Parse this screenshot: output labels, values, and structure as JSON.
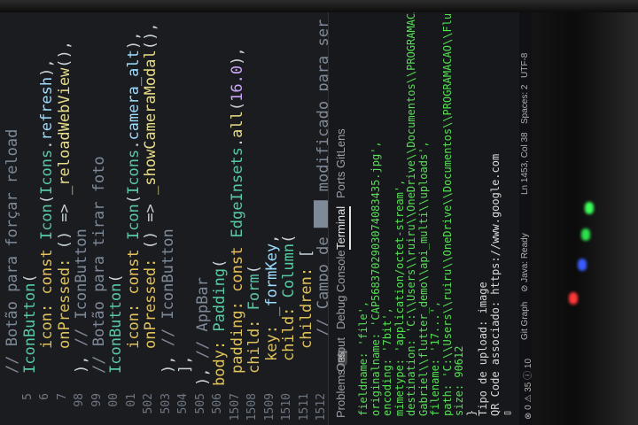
{
  "editor": {
    "line_numbers": [
      "",
      "5",
      "6",
      "7",
      "98",
      "99",
      "00",
      "01",
      "502",
      "503",
      "504",
      "505",
      "506",
      "1507",
      "1508",
      "1509",
      "1510",
      "1511",
      "1512"
    ],
    "lines": [
      {
        "parts": [
          [
            "cmt",
            "// Botão para forçar reload"
          ]
        ],
        "indent": 0
      },
      {
        "parts": [
          [
            "cls",
            "IconButton"
          ],
          [
            "pun",
            "("
          ]
        ],
        "indent": 0
      },
      {
        "parts": [
          [
            "prop",
            "icon: "
          ],
          [
            "kw",
            "const "
          ],
          [
            "cls",
            "Icon"
          ],
          [
            "pun",
            "("
          ],
          [
            "cls",
            "Icons"
          ],
          [
            "pun",
            "."
          ],
          [
            "ident",
            "refresh"
          ],
          [
            "pun",
            "),"
          ]
        ],
        "indent": 2
      },
      {
        "parts": [
          [
            "prop",
            "onPressed: "
          ],
          [
            "pun",
            "() => "
          ],
          [
            "fn",
            "_reloadWebView"
          ],
          [
            "pun",
            "(),"
          ]
        ],
        "indent": 2
      },
      {
        "parts": [
          [
            "pun",
            "), "
          ],
          [
            "cmt",
            "// IconButton"
          ]
        ],
        "indent": 0
      },
      {
        "parts": [
          [
            "cmt",
            "// Botão para tirar foto"
          ]
        ],
        "indent": 0
      },
      {
        "parts": [
          [
            "cls",
            "IconButton"
          ],
          [
            "pun",
            "("
          ]
        ],
        "indent": 0
      },
      {
        "parts": [
          [
            "prop",
            "icon: "
          ],
          [
            "kw",
            "const "
          ],
          [
            "cls",
            "Icon"
          ],
          [
            "pun",
            "("
          ],
          [
            "cls",
            "Icons"
          ],
          [
            "pun",
            "."
          ],
          [
            "ident",
            "camera_alt"
          ],
          [
            "pun",
            "),"
          ]
        ],
        "indent": 2
      },
      {
        "parts": [
          [
            "prop",
            "onPressed: "
          ],
          [
            "pun",
            "() => "
          ],
          [
            "fn",
            "_showCameraModal"
          ],
          [
            "pun",
            "(),"
          ]
        ],
        "indent": 2
      },
      {
        "parts": [
          [
            "pun",
            "), "
          ],
          [
            "cmt",
            "// IconButton"
          ]
        ],
        "indent": 0
      },
      {
        "parts": [
          [
            "pun",
            "],"
          ]
        ],
        "indent": 0
      },
      {
        "parts": [
          [
            "pun",
            "), "
          ],
          [
            "cmt",
            "// AppBar"
          ]
        ],
        "indent": -1
      },
      {
        "parts": [
          [
            "prop",
            "body: "
          ],
          [
            "cls",
            "Padding"
          ],
          [
            "pun",
            "("
          ]
        ],
        "indent": -1
      },
      {
        "parts": [
          [
            "prop",
            "padding: "
          ],
          [
            "kw",
            "const "
          ],
          [
            "cls",
            "EdgeInsets"
          ],
          [
            "pun",
            "."
          ],
          [
            "fn",
            "all"
          ],
          [
            "pun",
            "("
          ],
          [
            "num",
            "16.0"
          ],
          [
            "pun",
            "),"
          ]
        ],
        "indent": 0
      },
      {
        "parts": [
          [
            "prop",
            "child: "
          ],
          [
            "cls",
            "Form"
          ],
          [
            "pun",
            "("
          ]
        ],
        "indent": 0
      },
      {
        "parts": [
          [
            "prop",
            "key: "
          ],
          [
            "ident",
            "_formKey"
          ],
          [
            "pun",
            ","
          ]
        ],
        "indent": 1
      },
      {
        "parts": [
          [
            "prop",
            "child: "
          ],
          [
            "cls",
            "Column"
          ],
          [
            "pun",
            "("
          ]
        ],
        "indent": 1
      },
      {
        "parts": [
          [
            "prop",
            "children: "
          ],
          [
            "pun",
            "["
          ]
        ],
        "indent": 2
      },
      {
        "parts": [
          [
            "cmt",
            "// Campo de ███ modificado para ser apenas de l"
          ]
        ],
        "indent": 3
      }
    ]
  },
  "panel": {
    "tabs": [
      {
        "label": "Problems",
        "badge": "35"
      },
      {
        "label": "Output",
        "badge": ""
      },
      {
        "label": "Debug Console",
        "badge": ""
      },
      {
        "label": "Terminal",
        "badge": "",
        "active": true
      },
      {
        "label": "Ports",
        "badge": ""
      },
      {
        "label": "GitLens",
        "badge": ""
      }
    ],
    "terminal_lines": [
      {
        "c": "g",
        "t": "fieldname: 'file',"
      },
      {
        "c": "g",
        "t": "originalname: 'CAP5683702903074083435.jpg',"
      },
      {
        "c": "g",
        "t": "encoding: '7bit',"
      },
      {
        "c": "g",
        "t": "mimetype: 'application/octet-stream',"
      },
      {
        "c": "g",
        "t": "destination: 'C:\\\\Users\\\\ruiru\\\\OneDrive\\\\Documentos\\\\PROGRAMACAO\\\\Flutter\\\\"
      },
      {
        "c": "g",
        "t": "Gabriel\\\\flutter_demo\\\\api_multi\\\\uploads',"
      },
      {
        "c": "g",
        "t": "filename: '17...',"
      },
      {
        "c": "g",
        "t": "path: 'C:\\\\Users\\\\ruiru\\\\OneDrive\\\\Documentos\\\\PROGRAMACAO\\\\Flutter\\\\...',"
      },
      {
        "c": "g",
        "t": "size: 90612"
      },
      {
        "c": "w",
        "t": "}"
      },
      {
        "c": "w",
        "t": "Tipo de upload: image"
      },
      {
        "c": "w",
        "t": "QR Code associado: https://www.google.com"
      },
      {
        "c": "w",
        "t": "▯"
      }
    ]
  },
  "status_bar": {
    "items": [
      "⊗ 0 ⚠ 35 ⓘ 10",
      "Git Graph",
      "⊘ Java: Ready",
      "Ln 1453, Col 38",
      "Spaces: 2",
      "UTF-8"
    ]
  }
}
